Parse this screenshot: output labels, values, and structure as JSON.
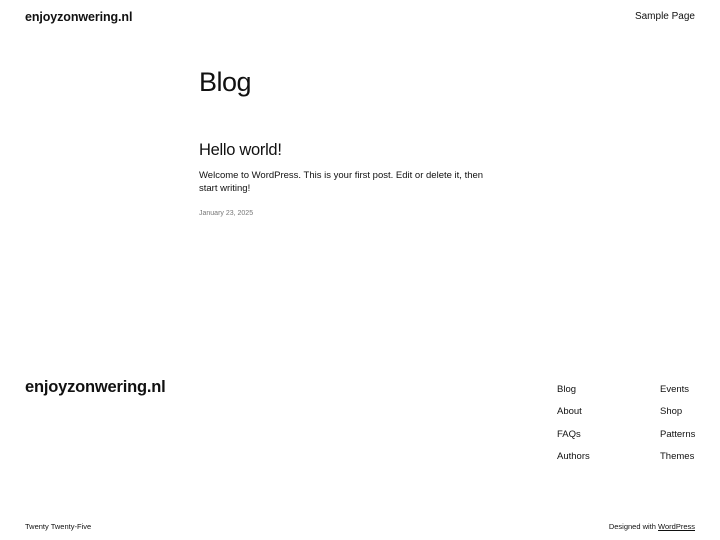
{
  "header": {
    "site_title": "enjoyzonwering.nl",
    "nav_item": "Sample Page"
  },
  "main": {
    "page_title": "Blog",
    "post": {
      "title": "Hello world!",
      "excerpt": "Welcome to WordPress. This is your first post. Edit or delete it, then start writing!",
      "date": "January 23, 2025"
    }
  },
  "footer": {
    "site_title": "enjoyzonwering.nl",
    "nav_col_1": [
      "Blog",
      "About",
      "FAQs",
      "Authors"
    ],
    "nav_col_2": [
      "Events",
      "Shop",
      "Patterns",
      "Themes"
    ],
    "theme_name": "Twenty Twenty-Five",
    "credit_prefix": "Designed with ",
    "credit_link": "WordPress"
  }
}
